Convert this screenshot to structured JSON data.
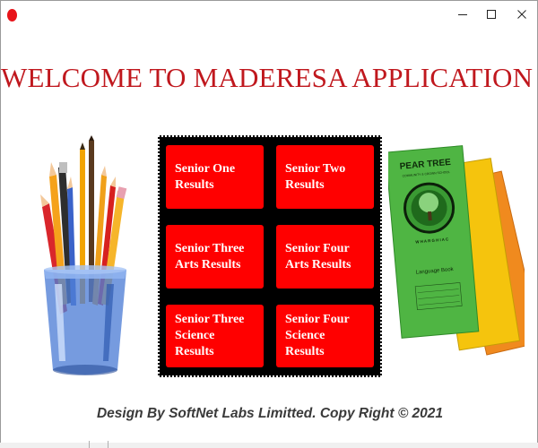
{
  "window": {
    "controls": {
      "minimize": "minimize-icon",
      "maximize": "maximize-icon",
      "close": "close-icon"
    }
  },
  "header": {
    "title": "WELCOME TO MADERESA APPLICATION"
  },
  "menu": {
    "tiles": [
      {
        "line1": "Senior One",
        "line2": "Results",
        "line3": ""
      },
      {
        "line1": "Senior Two",
        "line2": "Results",
        "line3": ""
      },
      {
        "line1": "Senior Three",
        "line2": "Arts Results",
        "line3": ""
      },
      {
        "line1": "Senior Four",
        "line2": "Arts Results",
        "line3": ""
      },
      {
        "line1": "Senior Three",
        "line2": "Science",
        "line3": "Results"
      },
      {
        "line1": "Senior Four",
        "line2": "Science",
        "line3": "Results"
      }
    ]
  },
  "book": {
    "title": "PEAR TREE",
    "subtitle": "COMMUNITY & CROWN SCHOOL",
    "motto": "W H A R G H I A C",
    "label": "Language Book"
  },
  "footer": {
    "credit": "Design By SoftNet Labs Limitted. Copy Right © 2021"
  },
  "colors": {
    "accent": "#c0181e",
    "tile": "#ff0000",
    "panel": "#000000",
    "footer_text": "#3a3a3a"
  }
}
